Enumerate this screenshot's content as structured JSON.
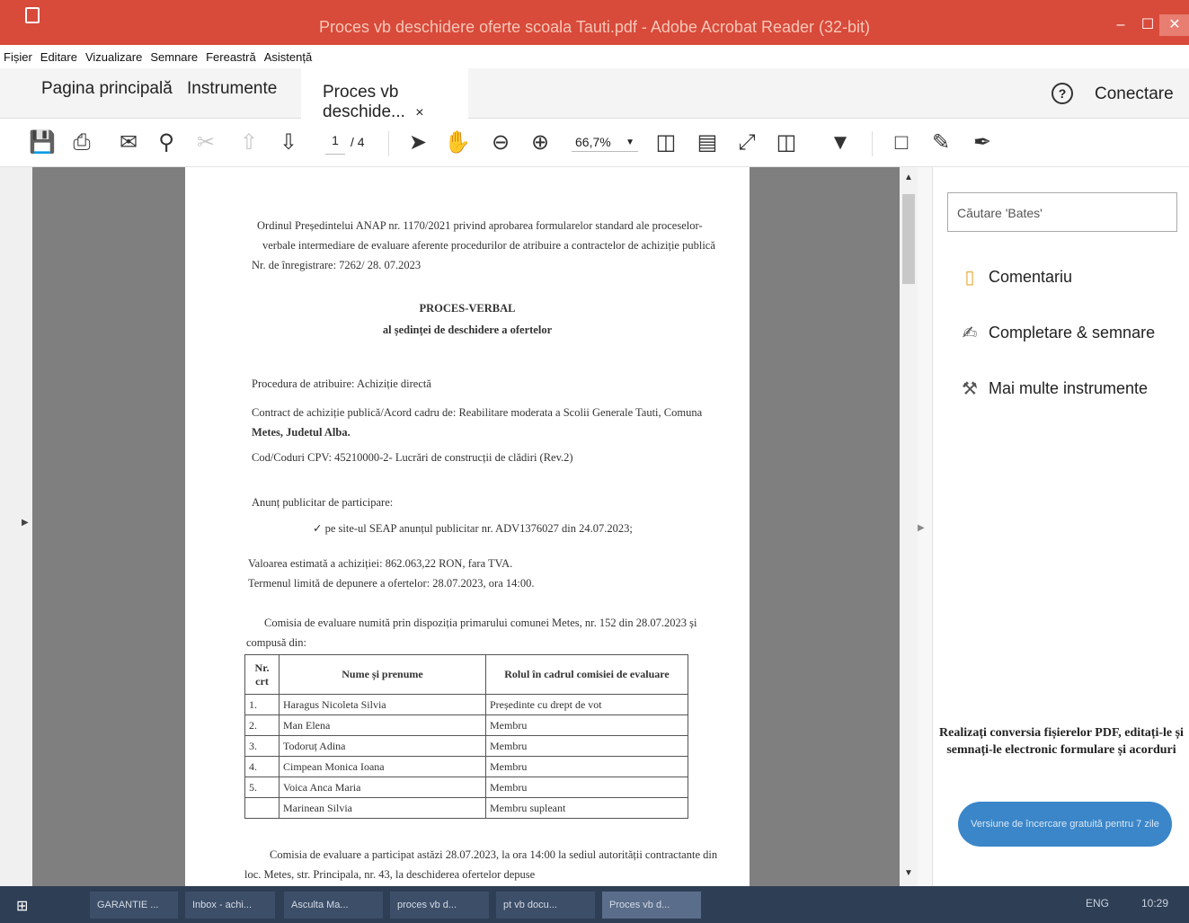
{
  "window": {
    "title": "Proces vb deschidere oferte scoala Tauti.pdf - Adobe Acrobat Reader (32-bit)",
    "min_glyph": "–",
    "max_glyph": "☐",
    "close_glyph": "✕"
  },
  "menu": [
    "Fișier",
    "Editare",
    "Vizualizare",
    "Semnare",
    "Fereastră",
    "Asistență"
  ],
  "tabs": {
    "home": "Pagina principală",
    "tools": "Instrumente",
    "doc": "Proces vb deschide...",
    "close": "×"
  },
  "header": {
    "help_glyph": "?",
    "signin": "Conectare"
  },
  "toolbar": {
    "page_current": "1",
    "page_total": "/ 4",
    "zoom": "66,7%",
    "zoom_caret": "▼"
  },
  "document": {
    "line1": "Ordinul Președintelui ANAP nr. 1170/2021 privind aprobarea formularelor standard ale proceselor-",
    "line2": "verbale intermediare de evaluare aferente procedurilor de atribuire a contractelor de achiziție publică",
    "registration": "Nr. de înregistrare: 7262/ 28. 07.2023",
    "heading": "PROCES-VERBAL",
    "subheading": "al ședinței de deschidere a ofertelor",
    "procedure": "Procedura de atribuire: Achiziție directă",
    "contract_a": "Contract de achiziție publică/Acord cadru de: Reabilitare moderata a Scolii Generale Tauti, Comuna",
    "contract_b": "Metes, Judetul Alba.",
    "cpv": "Cod/Coduri CPV: 45210000-2- Lucrări de construcții de clădiri (Rev.2)",
    "announce": "Anunț publicitar de participare:",
    "announce_item": "✓   pe site-ul SEAP anunțul publicitar nr. ADV1376027 din 24.07.2023;",
    "estimated": "Valoarea estimată a achiziției: 862.063,22 RON, fara TVA.",
    "deadline": "Termenul limită de depunere a ofertelor: 28.07.2023, ora 14:00.",
    "committee_a": "Comisia de evaluare numită prin dispoziția primarului comunei Metes, nr. 152 din 28.07.2023 și",
    "committee_b": "compusă din:",
    "table_headers": [
      "Nr. crt",
      "Nume și prenume",
      "Rolul în cadrul comisiei de evaluare"
    ],
    "members": [
      {
        "nr": "1.",
        "name": "Haragus Nicoleta Silvia",
        "role": "Președinte cu drept de vot"
      },
      {
        "nr": "2.",
        "name": "Man Elena",
        "role": "Membru"
      },
      {
        "nr": "3.",
        "name": "Todoruț Adina",
        "role": "Membru"
      },
      {
        "nr": "4.",
        "name": "Cimpean Monica Ioana",
        "role": "Membru"
      },
      {
        "nr": "5.",
        "name": "Voica Anca Maria",
        "role": "Membru"
      },
      {
        "nr": "",
        "name": "Marinean Silvia",
        "role": "Membru supleant"
      }
    ],
    "footer_a": "Comisia de evaluare a participat astăzi 28.07.2023, la ora 14:00 la sediul autorității contractante din",
    "footer_b": "loc. Metes, str. Principala, nr. 43, la deschiderea ofertelor depuse"
  },
  "right_panel": {
    "search_placeholder": "Căutare 'Bates'",
    "items": [
      {
        "label": "Comentariu",
        "icon": "comment-icon"
      },
      {
        "label": "Completare & semnare",
        "icon": "fill-sign-icon"
      },
      {
        "label": "Mai multe instrumente",
        "icon": "more-tools-icon"
      }
    ],
    "promo": "Realizați conversia fișierelor PDF, editați-le și semnați-le electronic formulare și acorduri",
    "trial_button": "Versiune de încercare gratuită pentru 7 zile"
  },
  "taskbar": {
    "items": [
      "GARANTIE ...",
      "Inbox - achi...",
      "Asculta Ma...",
      "proces vb d...",
      "pt vb docu...",
      "Proces vb d..."
    ],
    "lang": "ENG",
    "time": "10:29"
  }
}
